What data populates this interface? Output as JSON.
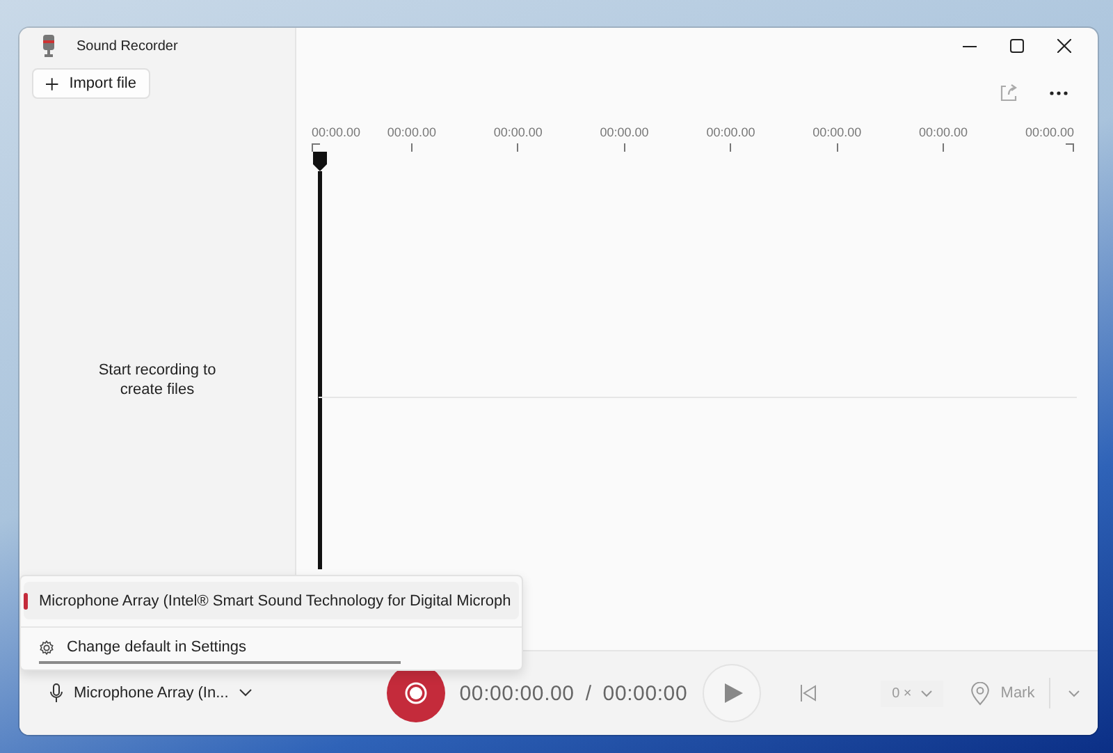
{
  "window": {
    "title": "Sound Recorder"
  },
  "sidebar": {
    "import_button": "Import file",
    "empty_message": "Start recording to create files"
  },
  "timeline": {
    "labels": [
      "00:00.00",
      "00:00.00",
      "00:00.00",
      "00:00.00",
      "00:00.00",
      "00:00.00",
      "00:00.00",
      "00:00.00"
    ]
  },
  "device_menu": {
    "items": [
      {
        "kind": "device",
        "label": "Microphone Array (Intel® Smart Sound Technology for Digital Microph",
        "selected": true
      },
      {
        "kind": "settings",
        "label": "Change default in Settings",
        "selected": false
      }
    ]
  },
  "bottom_bar": {
    "device": "Microphone Array (In...",
    "current_time": "00:00:00.00",
    "separator": "/",
    "total_time": "00:00:00",
    "speed": "0 ×",
    "mark": "Mark"
  }
}
